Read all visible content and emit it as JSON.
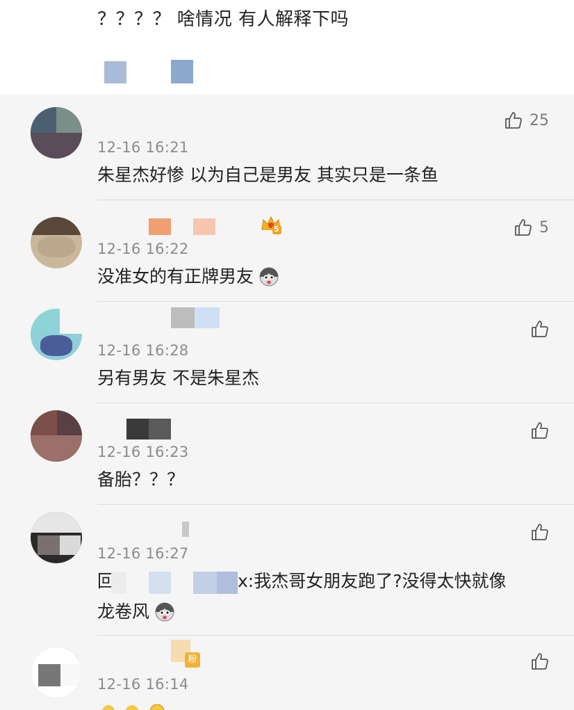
{
  "post": {
    "text": "？？？？ 啥情况 有人解释下吗"
  },
  "comments": [
    {
      "time": "12-16 16:21",
      "text": "朱星杰好惨 以为自己是男友 其实只是一条鱼",
      "likes": "25"
    },
    {
      "time": "12-16 16:22",
      "text": "没准女的有正牌男友",
      "likes": "5",
      "badge": "5"
    },
    {
      "time": "12-16 16:28",
      "text": "另有男友 不是朱星杰",
      "likes": ""
    },
    {
      "time": "12-16 16:23",
      "text": "备胎？？？",
      "likes": ""
    },
    {
      "time": "12-16 16:27",
      "reply_prefix": "回",
      "reply_tail": "x:我杰哥女朋友跑了?没得太快就像",
      "reply_line2": "龙卷风",
      "likes": ""
    },
    {
      "time": "12-16 16:14",
      "tag": "粉",
      "likes": ""
    }
  ],
  "icons": {
    "like": "thumbs-up-icon",
    "emoji": "husky-face-emoji-icon",
    "crown": "crown-badge-icon"
  },
  "colors": {
    "background": "#f5f5f5",
    "card": "#ffffff",
    "time": "#8b8b8b",
    "divider": "#dcdcdc"
  }
}
